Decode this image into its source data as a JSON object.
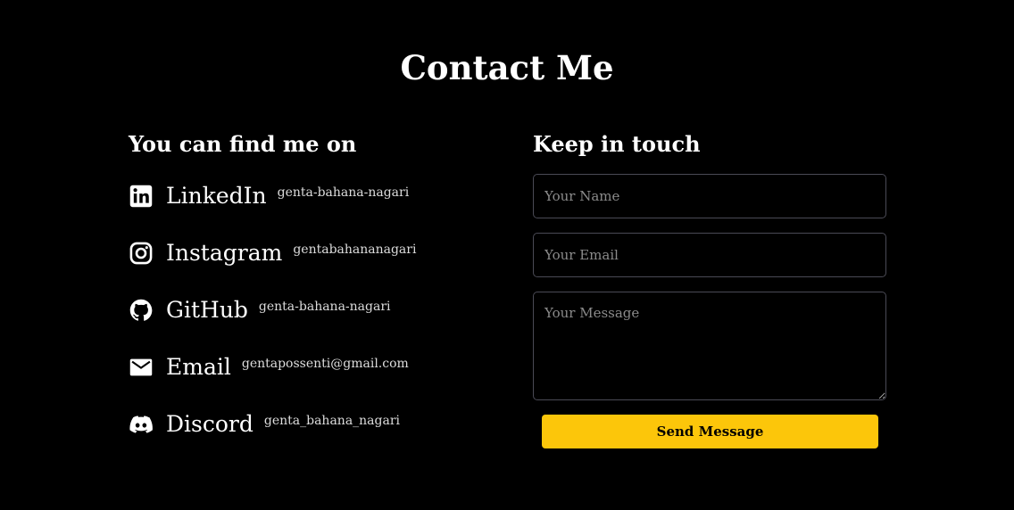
{
  "page": {
    "title": "Contact Me"
  },
  "social": {
    "heading": "You can find me on",
    "items": [
      {
        "name": "LinkedIn",
        "handle": "genta-bahana-nagari",
        "icon": "linkedin-icon"
      },
      {
        "name": "Instagram",
        "handle": "gentabahananagari",
        "icon": "instagram-icon"
      },
      {
        "name": "GitHub",
        "handle": "genta-bahana-nagari",
        "icon": "github-icon"
      },
      {
        "name": "Email",
        "handle": "gentapossenti@gmail.com",
        "icon": "mail-icon"
      },
      {
        "name": "Discord",
        "handle": "genta_bahana_nagari",
        "icon": "discord-icon"
      }
    ]
  },
  "contact_form": {
    "heading": "Keep in touch",
    "name_placeholder": "Your Name",
    "email_placeholder": "Your Email",
    "message_placeholder": "Your Message",
    "submit_label": "Send Message"
  },
  "colors": {
    "background": "#000000",
    "accent": "#fcc60a",
    "input_border": "#4a4a55"
  }
}
